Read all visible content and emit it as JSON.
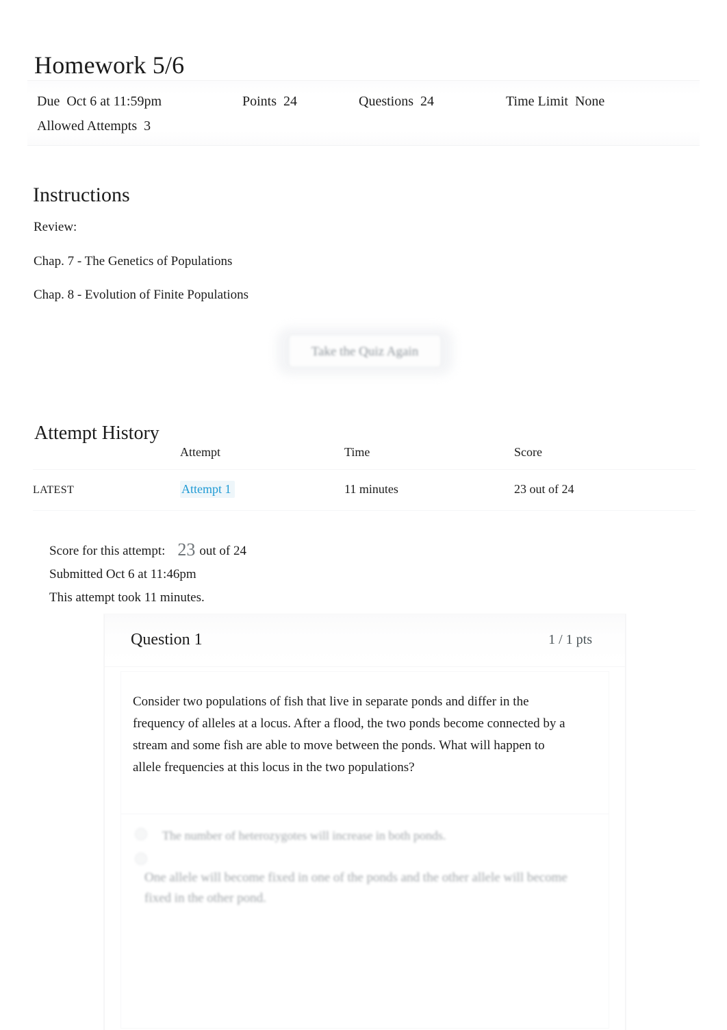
{
  "quiz": {
    "title": "Homework 5/6",
    "details": [
      {
        "label": "Due",
        "value": "Oct 6 at 11:59pm"
      },
      {
        "label": "Points",
        "value": "24"
      },
      {
        "label": "Questions",
        "value": "24"
      },
      {
        "label": "Time Limit",
        "value": "None"
      },
      {
        "label": "Allowed Attempts",
        "value": "3"
      }
    ]
  },
  "instructions": {
    "heading": "Instructions",
    "paragraphs": [
      "Review:",
      "Chap. 7 - The Genetics of Populations",
      "Chap. 8 - Evolution of Finite Populations"
    ]
  },
  "retake": {
    "label": "Take the Quiz Again"
  },
  "attempt_history": {
    "heading": "Attempt History",
    "columns": {
      "kept": "",
      "attempt": "Attempt",
      "time": "Time",
      "score": "Score"
    },
    "rows": [
      {
        "kept": "LATEST",
        "attempt": "Attempt 1",
        "time": "11 minutes",
        "score": "23 out of 24"
      }
    ]
  },
  "score_summary": {
    "score_label": "Score for this attempt:",
    "score_value": "23",
    "score_out_of": "out of 24",
    "submitted": "Submitted Oct 6 at 11:46pm",
    "duration": "This attempt took 11 minutes."
  },
  "question": {
    "name": "Question 1",
    "points": "1 / 1 pts",
    "text": "Consider two populations of fish that live in separate ponds and differ in the frequency of alleles at a locus. After a flood, the two ponds become connected by a stream and some fish are able to move between the ponds. What will happen to allele frequencies at this locus in the two populations?",
    "answers": [
      {
        "text": "The number of heterozygotes will increase in both ponds."
      },
      {
        "text": "One allele will become fixed in one of the ponds and the other allele will become fixed in the other pond."
      }
    ]
  },
  "colors": {
    "link_blue": "#1f9ad4",
    "text_dark": "#1b1b1b",
    "muted_gray": "#878d92"
  }
}
